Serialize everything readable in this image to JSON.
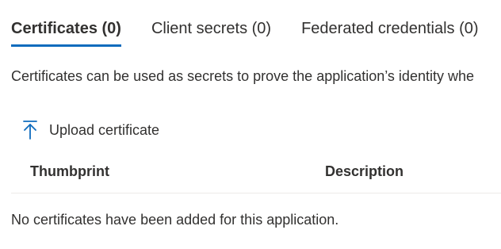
{
  "tabs": [
    {
      "label": "Certificates (0)",
      "active": true
    },
    {
      "label": "Client secrets (0)",
      "active": false
    },
    {
      "label": "Federated credentials (0)",
      "active": false
    }
  ],
  "description": "Certificates can be used as secrets to prove the application’s identity whe",
  "toolbar": {
    "upload_label": "Upload certificate",
    "upload_icon": "upload-arrow-icon"
  },
  "table": {
    "columns": [
      "Thumbprint",
      "Description"
    ],
    "empty_message": "No certificates have been added for this application."
  },
  "colors": {
    "accent": "#0f6cbd",
    "text": "#323130",
    "divider": "#edebe9"
  }
}
